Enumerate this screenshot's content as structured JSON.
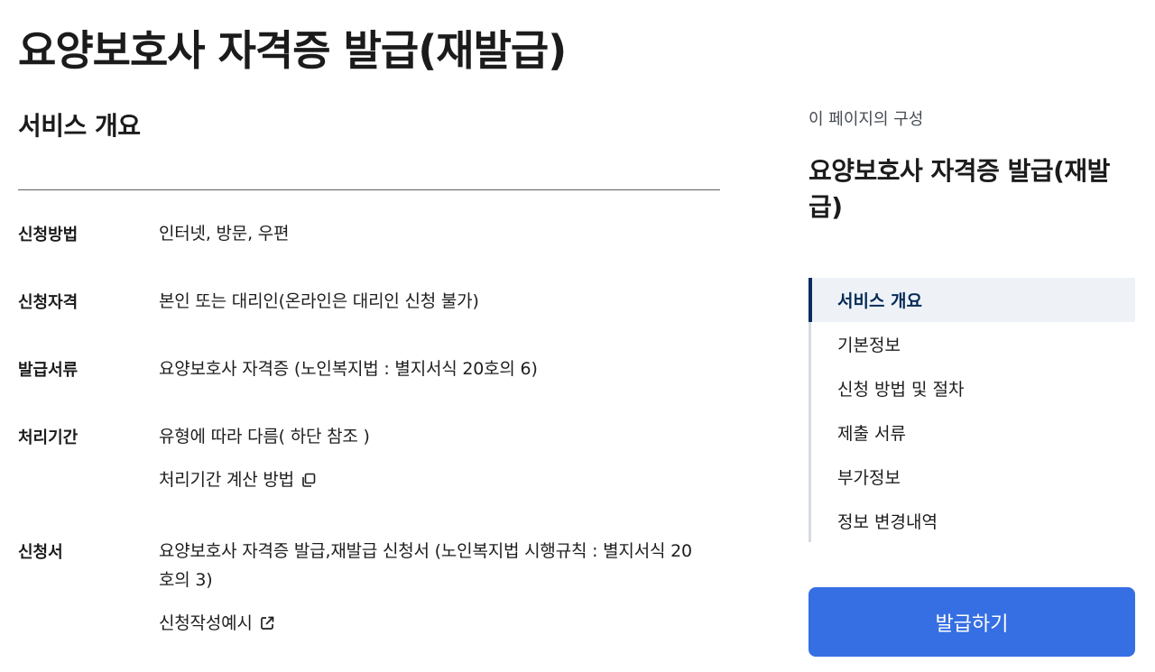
{
  "page": {
    "title": "요양보호사 자격증 발급(재발급)"
  },
  "overview": {
    "heading": "서비스 개요",
    "rows": [
      {
        "label": "신청방법",
        "value": "인터넷, 방문, 우편"
      },
      {
        "label": "신청자격",
        "value": "본인 또는 대리인(온라인은 대리인 신청 불가)"
      },
      {
        "label": "발급서류",
        "value": "요양보호사 자격증 (노인복지법 : 별지서식 20호의 6)"
      },
      {
        "label": "처리기간",
        "value": "유형에 따라 다름( 하단 참조 )",
        "link": "처리기간 계산 방법",
        "link_icon": "copy-icon"
      },
      {
        "label": "신청서",
        "value_line1": "요양보호사 자격증 발급,재발급 신청서 (노인복지법 시행규칙 : 별지서식 20",
        "value_line2": "호의 3)",
        "link": "신청작성예시",
        "link_icon": "external-link-icon"
      }
    ]
  },
  "toc": {
    "caption": "이 페이지의 구성",
    "title": "요양보호사 자격증 발급(재발급)",
    "items": [
      {
        "label": "서비스 개요",
        "active": true
      },
      {
        "label": "기본정보"
      },
      {
        "label": "신청 방법 및 절차"
      },
      {
        "label": "제출 서류"
      },
      {
        "label": "부가정보"
      },
      {
        "label": "정보 변경내역"
      }
    ]
  },
  "action": {
    "issue_label": "발급하기"
  },
  "colors": {
    "primary_button": "#366fe3",
    "toc_active_bg": "#eef2f7",
    "toc_active_bar": "#0b2e5f"
  }
}
